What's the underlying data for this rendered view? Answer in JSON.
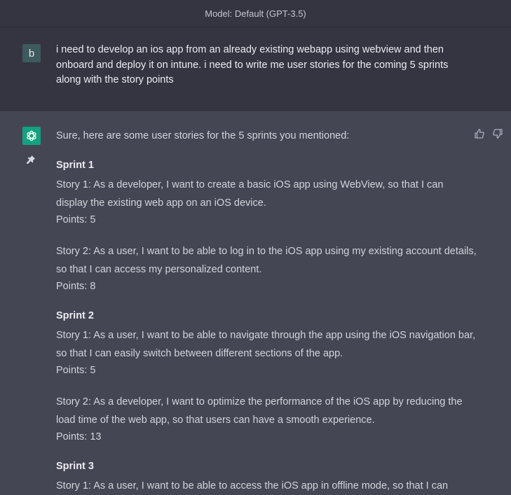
{
  "header": {
    "model_label": "Model: Default (GPT-3.5)"
  },
  "user_message": {
    "avatar_letter": "b",
    "text": "i need to develop an ios app from an already existing webapp using webview and then onboard and deploy it on intune. i need to write me user stories for the coming 5 sprints along with the story points"
  },
  "assistant_message": {
    "intro": "Sure, here are some user stories for the 5 sprints you mentioned:",
    "sprints": [
      {
        "title": "Sprint 1",
        "stories": [
          {
            "text": "Story 1: As a developer, I want to create a basic iOS app using WebView, so that I can display the existing web app on an iOS device.",
            "points": "Points: 5"
          },
          {
            "text": "Story 2: As a user, I want to be able to log in to the iOS app using my existing account details, so that I can access my personalized content.",
            "points": "Points: 8"
          }
        ]
      },
      {
        "title": "Sprint 2",
        "stories": [
          {
            "text": "Story 1: As a user, I want to be able to navigate through the app using the iOS navigation bar, so that I can easily switch between different sections of the app.",
            "points": "Points: 5"
          },
          {
            "text": "Story 2: As a developer, I want to optimize the performance of the iOS app by reducing the load time of the web app, so that users can have a smooth experience.",
            "points": "Points: 13"
          }
        ]
      },
      {
        "title": "Sprint 3",
        "stories": [
          {
            "text": "Story 1: As a user, I want to be able to access the iOS app in offline mode, so that I can"
          }
        ]
      }
    ]
  },
  "icons": {
    "assistant_avatar": "openai-logo-icon",
    "pin": "pin-icon",
    "thumbs_up": "thumbs-up-icon",
    "thumbs_down": "thumbs-down-icon"
  },
  "colors": {
    "user_bg": "#343541",
    "assistant_bg": "#444654",
    "assistant_avatar_bg": "#10a37f",
    "user_avatar_bg": "#3d5a5e"
  }
}
